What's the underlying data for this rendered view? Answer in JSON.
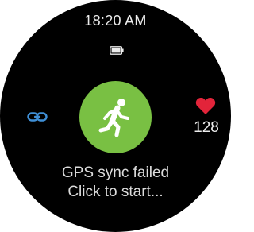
{
  "watch": {
    "time": "18:20 AM",
    "battery_icon": "battery-icon",
    "link_icon": "link-icon",
    "activity_icon": "running-person-icon",
    "heart_icon": "heart-icon",
    "heart_rate": "128",
    "status_line1": "GPS sync failed",
    "status_line2": "Click to start..."
  },
  "colors": {
    "background": "#000000",
    "accent_green": "#79c043",
    "link_blue": "#3f8fd6",
    "heart_red": "#e2243a",
    "text": "#e8e8e8"
  }
}
